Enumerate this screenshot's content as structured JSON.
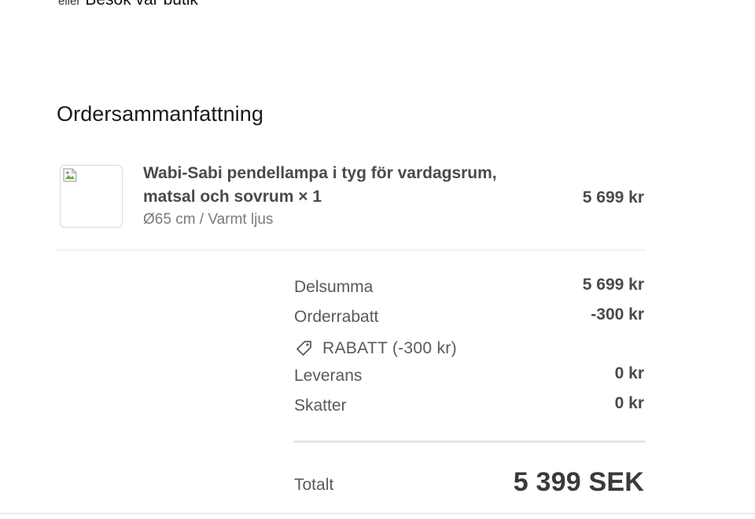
{
  "header": {
    "or_text": "eller",
    "visit_store_link": "Besök vår butik"
  },
  "summary": {
    "title": "Ordersammanfattning",
    "item": {
      "name": "Wabi-Sabi pendellampa i tyg för vardagsrum, matsal och sovrum × 1",
      "variant": "Ø65 cm / Varmt ljus",
      "price": "5 699 kr",
      "image_icon": "broken-image-icon"
    },
    "rows": {
      "subtotal": {
        "label": "Delsumma",
        "value": "5 699 kr"
      },
      "order_discount": {
        "label": "Orderrabatt",
        "value": "-300 kr"
      },
      "discount_code": {
        "label": "RABATT (-300 kr)",
        "icon": "tag-icon"
      },
      "shipping": {
        "label": "Leverans",
        "value": "0 kr"
      },
      "taxes": {
        "label": "Skatter",
        "value": "0 kr"
      }
    },
    "total": {
      "label": "Totalt",
      "value": "5 399 SEK"
    }
  },
  "colors": {
    "text_primary": "#222222",
    "text_secondary": "#5a5a5a",
    "divider": "#e6e6e6"
  }
}
